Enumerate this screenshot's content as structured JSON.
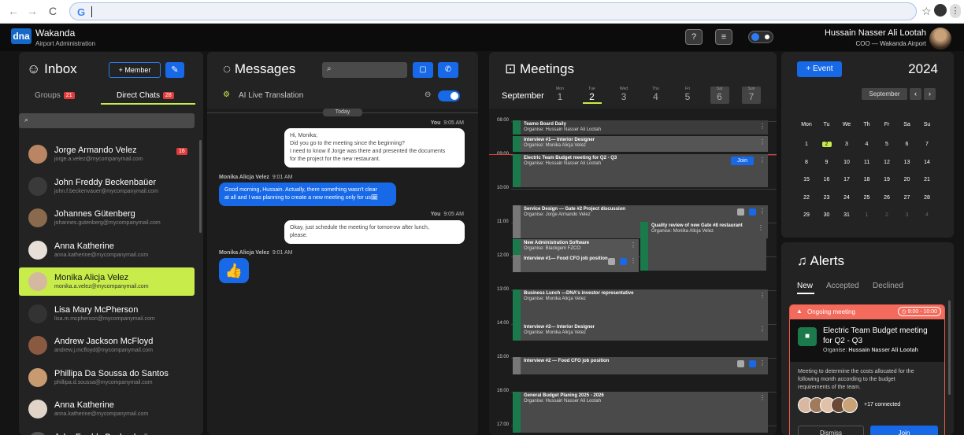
{
  "topbar": {
    "app_name": "Wakanda",
    "app_sub": "Airport Administration",
    "logo": "dna",
    "user_name": "Hussain Nasser Ali Lootah",
    "user_role": "COO — Wakanda Airport"
  },
  "inbox": {
    "title": "Inbox",
    "member_btn": "+ Member",
    "tab_groups": "Groups",
    "groups_count": "21",
    "tab_direct": "Direct Chats",
    "direct_count": "28",
    "contacts": [
      {
        "name": "Jorge Armando Velez",
        "email": "jorge.a.velez@mycompanymail.com",
        "badge": "16"
      },
      {
        "name": "John Freddy Beckenbaüer",
        "email": "john.f.beckenvauer@mycompanymail.com"
      },
      {
        "name": "Johannes Gütenberg",
        "email": "johannes.gutenberg@mycompanymail.com"
      },
      {
        "name": "Anna Katherine",
        "email": "anna.katherine@mycompanymail.com"
      },
      {
        "name": "Monika Alicja Velez",
        "email": "monika.a.velez@mycompanymail.com"
      },
      {
        "name": "Lisa Mary McPherson",
        "email": "lisa.m.mcpherson@mycompanymail.com"
      },
      {
        "name": "Andrew Jackson McFloyd",
        "email": "andrew.j.mcfloyd@mycompanymail.com"
      },
      {
        "name": "Phillipa Da Soussa do Santos",
        "email": "phillipa.d.soussa@mycompanymail.com"
      },
      {
        "name": "Anna Katherine",
        "email": "anna.katherine@mycompanymail.com"
      },
      {
        "name": "John Freddy Beckenbaüer",
        "email": ""
      }
    ]
  },
  "messages": {
    "title": "Messages",
    "ai_label": "AI Live Translation",
    "day": "Today",
    "m1_from": "You",
    "m1_time": "9:05 AM",
    "m1_l1": "Hi, Monika;",
    "m1_l2": "Did you go to the meeting since the beginning?",
    "m1_l3": "I need to know if Jorge was there and presented the documents",
    "m1_l4": "for the project for the new restaurant.",
    "m2_from": "Monika Alicja Velez",
    "m2_time": "9:01 AM",
    "m2_l1": "Good morning, Hussain. Actually, there something wasn't clear",
    "m2_l2": "at all and I was planning to create a new meeting only for us🗓",
    "m3_from": "You",
    "m3_time": "9:05 AM",
    "m3_l1": "Okay, just schedule the meeting for tomorrow after lunch,",
    "m3_l2": "please.",
    "m4_from": "Monika Alicja Velez",
    "m4_time": "9:01 AM",
    "m4_emoji": "👍"
  },
  "meetings": {
    "title": "Meetings",
    "month": "September",
    "days": [
      {
        "d": "Mon",
        "n": "1"
      },
      {
        "d": "Tue",
        "n": "2"
      },
      {
        "d": "Wed",
        "n": "3"
      },
      {
        "d": "Thu",
        "n": "4"
      },
      {
        "d": "Fri",
        "n": "5"
      },
      {
        "d": "Sat",
        "n": "6"
      },
      {
        "d": "Sun",
        "n": "7"
      }
    ],
    "hours": [
      "08:00",
      "09:00",
      "10:00",
      "11:00",
      "12:00",
      "13:00",
      "14:00",
      "15:00",
      "16:00",
      "17:00"
    ],
    "join": "Join",
    "events": [
      {
        "t": "Teamo Board Daily",
        "o": "Organise: Hussain Nasser Ali Lootah"
      },
      {
        "t": "Interview #1— Interior Designer",
        "o": "Organise: Monika Alicja Velez"
      },
      {
        "t": "Electric Team Budget meeting for Q2 - Q3",
        "o": "Organise: Hussain Nasser Ali Lootah"
      },
      {
        "t": "Service Design — Gate #2 Project discussion",
        "o": "Organise: Jorge Armando Velez"
      },
      {
        "t": "Quality review of new Gate #8 restaurant",
        "o": "Organise: Monika Alicja Velez"
      },
      {
        "t": "New Administration Software",
        "o": "Organise: Blackgem FZCO"
      },
      {
        "t": "Interview #1— Food CFO job position",
        "o": ""
      },
      {
        "t": "Business Lunch —DNA's investor representative",
        "o": "Organise: Monika Alicja Velez"
      },
      {
        "t": "Interview #2— Interior Designer",
        "o": "Organise: Monika Alicja Velez"
      },
      {
        "t": "Interview #2 — Food CFO job position",
        "o": ""
      },
      {
        "t": "General Budget Planing 2025 - 2026",
        "o": "Organise: Hussain Nasser Ali Lootah"
      }
    ]
  },
  "calendar": {
    "event_btn": "+ Event",
    "year": "2024",
    "month": "September",
    "weekdays": [
      "Mon",
      "Tu",
      "We",
      "Th",
      "Fr",
      "Sa",
      "Su"
    ],
    "weeks": [
      [
        "1",
        "2",
        "3",
        "4",
        "5",
        "6",
        "7"
      ],
      [
        "8",
        "9",
        "10",
        "11",
        "12",
        "13",
        "14"
      ],
      [
        "15",
        "16",
        "17",
        "18",
        "19",
        "20",
        "21"
      ],
      [
        "22",
        "23",
        "24",
        "25",
        "26",
        "27",
        "28"
      ],
      [
        "29",
        "30",
        "31",
        "1",
        "2",
        "3",
        "4"
      ]
    ],
    "selected": "2"
  },
  "alerts": {
    "title": "Alerts",
    "tabs": [
      "New",
      "Accepted",
      "Declined"
    ],
    "ongoing": "Ongoing meeting",
    "time": "9:00 - 10:00",
    "meeting_title_1": "Electric Team Budget meeting",
    "meeting_title_2": "for Q2 - Q3",
    "organise": "Organise:",
    "organiser": "Hussain Nasser Ali Lootah",
    "desc_1": "Meeting to determine the costs allocated for the",
    "desc_2": "following month according to the budget",
    "desc_3": "requirements of the team.",
    "connected": "+17 connected",
    "dismiss": "Dismiss",
    "join": "Join"
  }
}
